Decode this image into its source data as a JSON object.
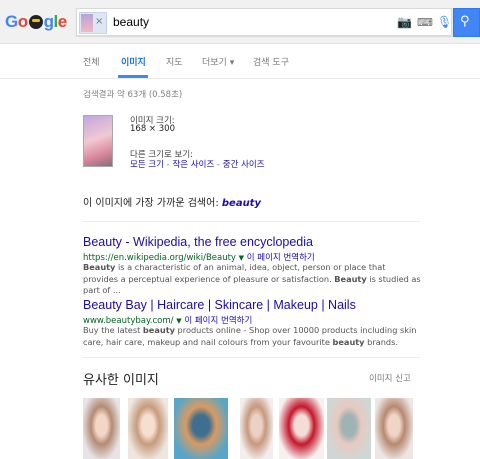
{
  "logo": {
    "text": "Google"
  },
  "search": {
    "query": "beauty",
    "clear_glyph": "×"
  },
  "tabs": [
    {
      "label": "전체",
      "active": false
    },
    {
      "label": "이미지",
      "active": true
    },
    {
      "label": "지도",
      "active": false
    },
    {
      "label": "더보기 ▾",
      "active": false
    },
    {
      "label": "검색 도구",
      "active": false
    }
  ],
  "stats": "검색결과 약 63개 (0.58초)",
  "source_image": {
    "size_label": "이미지 크기:",
    "size_value": "168 × 300",
    "other_sizes_label": "다른 크기로 보기:",
    "links": [
      "모든 크기",
      "작은 사이즈",
      "중간 사이즈"
    ],
    "sep": " - "
  },
  "best_guess": {
    "prefix": "이 이미지에 가장 가까운 검색어: ",
    "term": "beauty"
  },
  "results": [
    {
      "title": "Beauty - Wikipedia, the free encyclopedia",
      "url": "https://en.wikipedia.org/wiki/Beauty",
      "translate": "이 페이지 번역하기",
      "snippet": "Beauty is a characteristic of an animal, idea, object, person or place that provides a perceptual experience of pleasure or satisfaction. Beauty is studied as part of ..."
    },
    {
      "title": "Beauty Bay | Haircare | Skincare | Makeup | Nails",
      "url": "www.beautybay.com/",
      "translate": "이 페이지 번역하기",
      "snippet": "Buy the latest beauty products online - Shop over 10000 products including skin care, hair care, makeup and nail colours from your favourite beauty brands."
    }
  ],
  "similar": {
    "title": "유사한 이미지",
    "report": "이미지 신고",
    "thumbs": [
      {
        "name": "similar-image-1",
        "colors": [
          "#e8e3e6",
          "#b48b74",
          "#f2d6c6"
        ]
      },
      {
        "name": "similar-image-2",
        "colors": [
          "#efe6df",
          "#c69b7c",
          "#f6dfcf"
        ]
      },
      {
        "name": "similar-image-3",
        "colors": [
          "#58a6c7",
          "#d99a62",
          "#3f6f8f"
        ]
      },
      {
        "name": "similar-image-4",
        "colors": [
          "#f3eeec",
          "#c7987f",
          "#ecd2c4"
        ]
      },
      {
        "name": "similar-image-5",
        "colors": [
          "#f6f0ee",
          "#c4172c",
          "#f3ddd6"
        ]
      },
      {
        "name": "similar-image-6",
        "colors": [
          "#cfd7d6",
          "#e8c9c0",
          "#9fb2b4"
        ]
      },
      {
        "name": "similar-image-7",
        "colors": [
          "#ece6e4",
          "#b88870",
          "#f0d5c7"
        ]
      }
    ]
  }
}
